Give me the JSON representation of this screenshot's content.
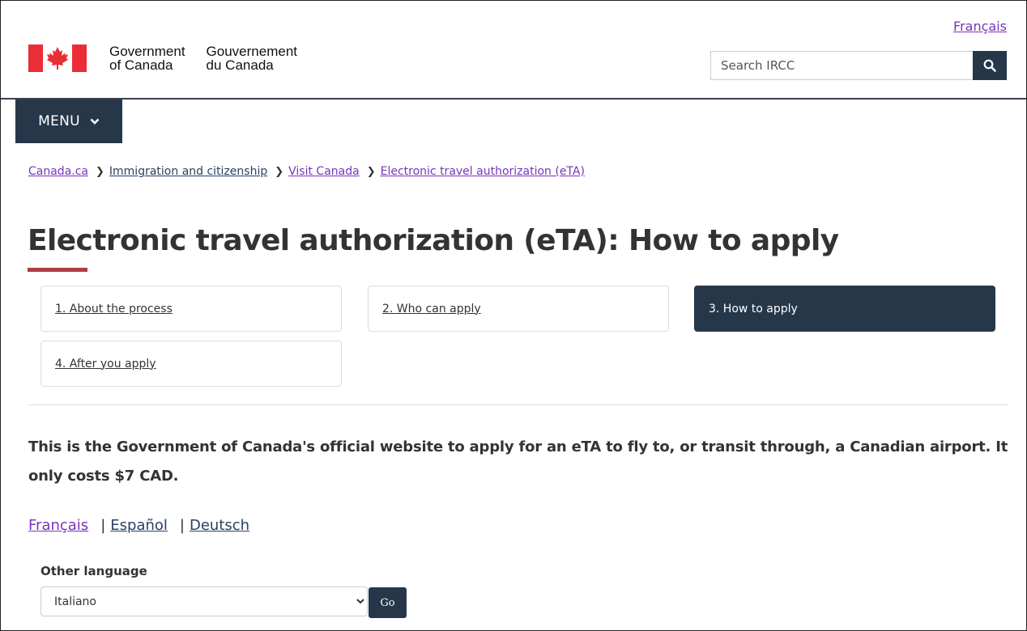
{
  "header": {
    "language_toggle": "Français",
    "government_en_line1": "Government",
    "government_en_line2": "of Canada",
    "government_fr_line1": "Gouvernement",
    "government_fr_line2": "du Canada",
    "search_placeholder": "Search IRCC",
    "menu_label": "MENU"
  },
  "breadcrumb": [
    {
      "label": "Canada.ca"
    },
    {
      "label": "Immigration and citizenship"
    },
    {
      "label": "Visit Canada"
    },
    {
      "label": "Electronic travel authorization (eTA)"
    }
  ],
  "main": {
    "title": "Electronic travel authorization (eTA): How to apply",
    "steps": [
      {
        "label": "1. About the process"
      },
      {
        "label": "2. Who can apply"
      },
      {
        "label": "3. How to apply",
        "active": true
      },
      {
        "label": "4. After you apply"
      }
    ],
    "intro": "This is the Government of Canada's official website to apply for an eTA to fly to, or transit through, a Canadian airport. It only costs $7 CAD.",
    "languages": [
      "Français",
      "Español",
      "Deutsch"
    ],
    "other_language_label": "Other language",
    "other_language_selected": "Italiano",
    "go_label": "Go"
  },
  "colors": {
    "primary_dark": "#26374a",
    "visited_link": "#7834bc",
    "link": "#284162",
    "flag_red": "#eb2d37",
    "title_accent": "#af3c43"
  },
  "icons": [
    "canada-flag-icon",
    "search-icon",
    "chevron-down-icon",
    "breadcrumb-chevron-icon"
  ]
}
